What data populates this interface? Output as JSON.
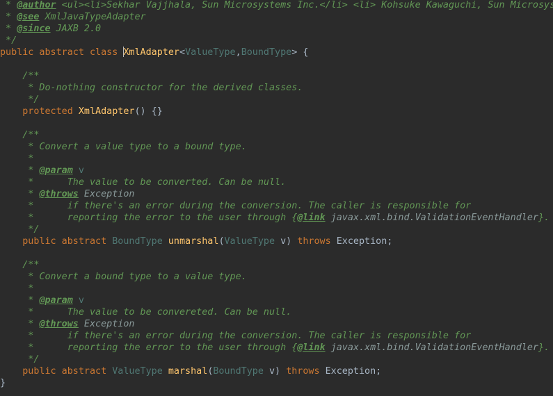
{
  "editor": {
    "colors": {
      "background": "#2b2b2b",
      "plain": "#a9b7c6",
      "keyword": "#cc7832",
      "doc_comment": "#629755",
      "doc_tag": "#629755",
      "class_name": "#ffc66d",
      "type_param": "#507874",
      "link_ref": "#8a9a9a"
    },
    "lines": [
      [
        {
          "t": " * ",
          "c": "doc"
        },
        {
          "t": "@author",
          "c": "tag"
        },
        {
          "t": " <ul><li>Sekhar Vajjhala, Sun Microsystems Inc.</li> <li> Kohsuke Kawaguchi, Sun Microsystems Inc.</li></ul>",
          "c": "doc"
        }
      ],
      [
        {
          "t": " * ",
          "c": "doc"
        },
        {
          "t": "@see",
          "c": "tag"
        },
        {
          "t": " XmlJavaTypeAdapter",
          "c": "doc"
        }
      ],
      [
        {
          "t": " * ",
          "c": "doc"
        },
        {
          "t": "@since",
          "c": "tag"
        },
        {
          "t": " JAXB 2.0",
          "c": "doc"
        }
      ],
      [
        {
          "t": " */",
          "c": "doc"
        }
      ],
      [
        {
          "t": "public abstract class ",
          "c": "kw"
        },
        {
          "t": "CARET",
          "c": "caret"
        },
        {
          "t": "XmlAdapter",
          "c": "cls"
        },
        {
          "t": "<",
          "c": "plain"
        },
        {
          "t": "ValueType",
          "c": "tp"
        },
        {
          "t": ",",
          "c": "plain"
        },
        {
          "t": "BoundType",
          "c": "tp"
        },
        {
          "t": "> {",
          "c": "plain"
        }
      ],
      [],
      [
        {
          "t": "    /**",
          "c": "doc"
        }
      ],
      [
        {
          "t": "     * Do-nothing constructor for the derived classes.",
          "c": "doc"
        }
      ],
      [
        {
          "t": "     */",
          "c": "doc"
        }
      ],
      [
        {
          "t": "    protected ",
          "c": "kw"
        },
        {
          "t": "XmlAdapter",
          "c": "cls"
        },
        {
          "t": "() {}",
          "c": "plain"
        }
      ],
      [],
      [
        {
          "t": "    /**",
          "c": "doc"
        }
      ],
      [
        {
          "t": "     * Convert a value type to a bound type.",
          "c": "doc"
        }
      ],
      [
        {
          "t": "     *",
          "c": "doc"
        }
      ],
      [
        {
          "t": "     * ",
          "c": "doc"
        },
        {
          "t": "@param",
          "c": "tag"
        },
        {
          "t": " v",
          "c": "tp"
        }
      ],
      [
        {
          "t": "     *      The value to be converted. Can be null.",
          "c": "doc"
        }
      ],
      [
        {
          "t": "     * ",
          "c": "doc"
        },
        {
          "t": "@throws",
          "c": "tag"
        },
        {
          "t": " Exception",
          "c": "ref"
        }
      ],
      [
        {
          "t": "     *      if there's an error during the conversion. The caller is responsible for",
          "c": "doc"
        }
      ],
      [
        {
          "t": "     *      reporting the error to the user through {",
          "c": "doc"
        },
        {
          "t": "@link",
          "c": "tag"
        },
        {
          "t": " javax.xml.bind.ValidationEventHandler",
          "c": "ref"
        },
        {
          "t": "}.",
          "c": "doc"
        }
      ],
      [
        {
          "t": "     */",
          "c": "doc"
        }
      ],
      [
        {
          "t": "    public abstract ",
          "c": "kw"
        },
        {
          "t": "BoundType",
          "c": "tp"
        },
        {
          "t": " ",
          "c": "plain"
        },
        {
          "t": "unmarshal",
          "c": "cls"
        },
        {
          "t": "(",
          "c": "plain"
        },
        {
          "t": "ValueType",
          "c": "tp"
        },
        {
          "t": " v) ",
          "c": "plain"
        },
        {
          "t": "throws",
          "c": "kw"
        },
        {
          "t": " Exception;",
          "c": "plain"
        }
      ],
      [],
      [
        {
          "t": "    /**",
          "c": "doc"
        }
      ],
      [
        {
          "t": "     * Convert a bound type to a value type.",
          "c": "doc"
        }
      ],
      [
        {
          "t": "     *",
          "c": "doc"
        }
      ],
      [
        {
          "t": "     * ",
          "c": "doc"
        },
        {
          "t": "@param",
          "c": "tag"
        },
        {
          "t": " v",
          "c": "tp"
        }
      ],
      [
        {
          "t": "     *      The value to be convereted. Can be null.",
          "c": "doc"
        }
      ],
      [
        {
          "t": "     * ",
          "c": "doc"
        },
        {
          "t": "@throws",
          "c": "tag"
        },
        {
          "t": " Exception",
          "c": "ref"
        }
      ],
      [
        {
          "t": "     *      if there's an error during the conversion. The caller is responsible for",
          "c": "doc"
        }
      ],
      [
        {
          "t": "     *      reporting the error to the user through {",
          "c": "doc"
        },
        {
          "t": "@link",
          "c": "tag"
        },
        {
          "t": " javax.xml.bind.ValidationEventHandler",
          "c": "ref"
        },
        {
          "t": "}.",
          "c": "doc"
        }
      ],
      [
        {
          "t": "     */",
          "c": "doc"
        }
      ],
      [
        {
          "t": "    public abstract ",
          "c": "kw"
        },
        {
          "t": "ValueType",
          "c": "tp"
        },
        {
          "t": " ",
          "c": "plain"
        },
        {
          "t": "marshal",
          "c": "cls"
        },
        {
          "t": "(",
          "c": "plain"
        },
        {
          "t": "BoundType",
          "c": "tp"
        },
        {
          "t": " v) ",
          "c": "plain"
        },
        {
          "t": "throws",
          "c": "kw"
        },
        {
          "t": " Exception;",
          "c": "plain"
        }
      ],
      [
        {
          "t": "}",
          "c": "plain"
        }
      ]
    ]
  }
}
